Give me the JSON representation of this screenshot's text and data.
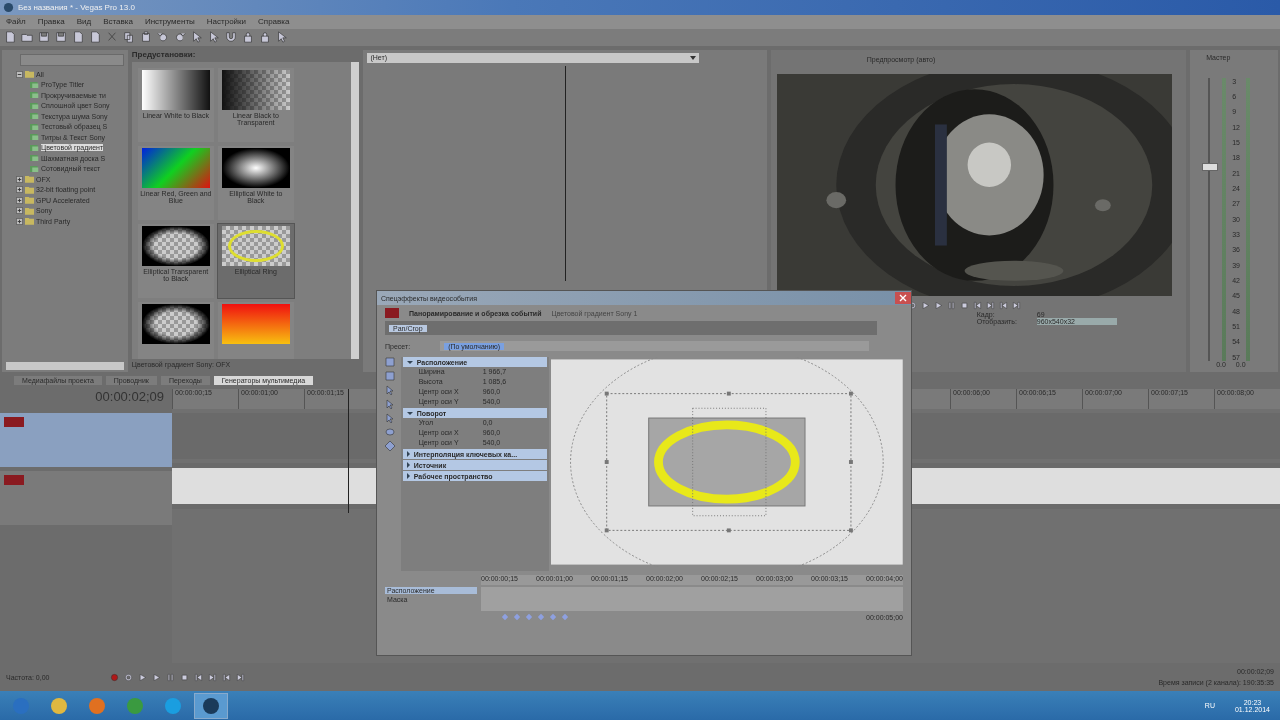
{
  "window": {
    "title": "Без названия * - Vegas Pro 13.0"
  },
  "menu": [
    "Файл",
    "Правка",
    "Вид",
    "Вставка",
    "Инструменты",
    "Настройки",
    "Справка"
  ],
  "tree": [
    {
      "label": "All",
      "expanded": true,
      "children": [
        {
          "label": "ProType Titler",
          "selected": false
        },
        {
          "label": "Прокручиваемые ти",
          "selected": false
        },
        {
          "label": "Сплошной цвет Sony",
          "selected": false
        },
        {
          "label": "Текстура шума Sony",
          "selected": false
        },
        {
          "label": "Тестовый образец S",
          "selected": false
        },
        {
          "label": "Титры & Текст Sony",
          "selected": false
        },
        {
          "label": "Цветовой градиент",
          "selected": true
        },
        {
          "label": "Шахматная доска S",
          "selected": false
        },
        {
          "label": "Сотовидный текст",
          "selected": false
        }
      ]
    },
    {
      "label": "OFX",
      "expanded": false
    },
    {
      "label": "32-bit floating point",
      "expanded": false
    },
    {
      "label": "GPU Accelerated",
      "expanded": false
    },
    {
      "label": "Sony",
      "expanded": false
    },
    {
      "label": "Third Party",
      "expanded": false
    }
  ],
  "presets": {
    "title": "Предустановки:",
    "status": "Цветовой градиент Sony: OFX",
    "items": [
      {
        "kind": "linear-wb",
        "label": "Linear White to Black",
        "selected": false
      },
      {
        "kind": "linear-bt",
        "label": "Linear Black to Transparent",
        "selected": false
      },
      {
        "kind": "rgb",
        "label": "Linear Red, Green and Blue",
        "selected": false
      },
      {
        "kind": "ellipse-wb",
        "label": "Elliptical White to Black",
        "selected": false
      },
      {
        "kind": "ellipse-tb",
        "label": "Elliptical Transparent to Black",
        "selected": false
      },
      {
        "kind": "ring",
        "label": "Elliptical Ring",
        "selected": true
      },
      {
        "kind": "rect-tb",
        "selected": false
      },
      {
        "kind": "red-yellow",
        "selected": false
      }
    ]
  },
  "tabs": [
    {
      "label": "Медиафайлы проекта",
      "selected": false
    },
    {
      "label": "Проводник",
      "selected": false
    },
    {
      "label": "Переходы",
      "selected": false
    },
    {
      "label": "Генераторы мультимедиа",
      "selected": true
    }
  ],
  "trimmer": {
    "source": "(Нет)"
  },
  "preview": {
    "quality": "Предпросмотр (авто)",
    "frame_label": "Кадр:",
    "frame": "69",
    "display_label": "Отобразить:",
    "display": "960x540x32"
  },
  "master": {
    "title": "Мастер",
    "level": 0.67,
    "ticks": [
      "3",
      "6",
      "9",
      "12",
      "15",
      "18",
      "21",
      "24",
      "27",
      "30",
      "33",
      "36",
      "39",
      "42",
      "45",
      "48",
      "51",
      "54",
      "57"
    ],
    "readings": [
      "0.0",
      "0.0"
    ]
  },
  "timeline": {
    "time": "00:00:02;09",
    "ruler_left": [
      "00:00:00;15",
      "00:00:01;00",
      "00:00:01;15"
    ],
    "ruler_right": [
      "00:00:06;00",
      "00:00:06;15",
      "00:00:07;00",
      "00:00:07;15",
      "00:00:08;00"
    ],
    "tracks": [
      {
        "has_event": false
      },
      {
        "has_event": true
      }
    ]
  },
  "dialog": {
    "title": "Спецэффекты видеособытия",
    "plugin": "Панорамирование и обрезка событий",
    "event": "Цветовой градиент Sony 1",
    "chain": "Pan/Crop",
    "preset_label": "Пресет:",
    "preset": "(По умолчанию)",
    "groups": [
      {
        "label": "Расположение",
        "expanded": true,
        "props": [
          {
            "name": "Ширина",
            "value": "1 966,7"
          },
          {
            "name": "Высота",
            "value": "1 085,6"
          },
          {
            "name": "Центр оси X",
            "value": "960,0"
          },
          {
            "name": "Центр оси Y",
            "value": "540,0"
          }
        ]
      },
      {
        "label": "Поворот",
        "expanded": true,
        "props": [
          {
            "name": "Угол",
            "value": "0,0"
          },
          {
            "name": "Центр оси X",
            "value": "960,0"
          },
          {
            "name": "Центр оси Y",
            "value": "540,0"
          }
        ]
      },
      {
        "label": "Интерполяция ключевых ка...",
        "expanded": false
      },
      {
        "label": "Источник",
        "expanded": false
      },
      {
        "label": "Рабочее пространство",
        "expanded": false
      }
    ],
    "keyframe_rows": [
      {
        "label": "Расположение",
        "selected": true
      },
      {
        "label": "Маска",
        "selected": false
      }
    ],
    "ruler": [
      "00:00:00;15",
      "00:00:01;00",
      "00:00:01;15",
      "00:00:02;00",
      "00:00:02;15",
      "00:00:03;00",
      "00:00:03;15",
      "00:00:04;00"
    ],
    "time": "00:00:05;00"
  },
  "transport": {
    "rate": "Частота: 0,00",
    "time": "00:00:02;09",
    "record": "Время записи (2 канала): 190:35:35"
  },
  "taskbar": {
    "apps": [
      {
        "kind": "start",
        "selected": false
      },
      {
        "kind": "folder",
        "selected": false
      },
      {
        "kind": "media",
        "selected": false
      },
      {
        "kind": "browser",
        "selected": false
      },
      {
        "kind": "chat",
        "selected": false
      },
      {
        "kind": "editor",
        "selected": true
      }
    ],
    "lang": "RU",
    "time": "20:23",
    "date": "01.12.2014"
  }
}
